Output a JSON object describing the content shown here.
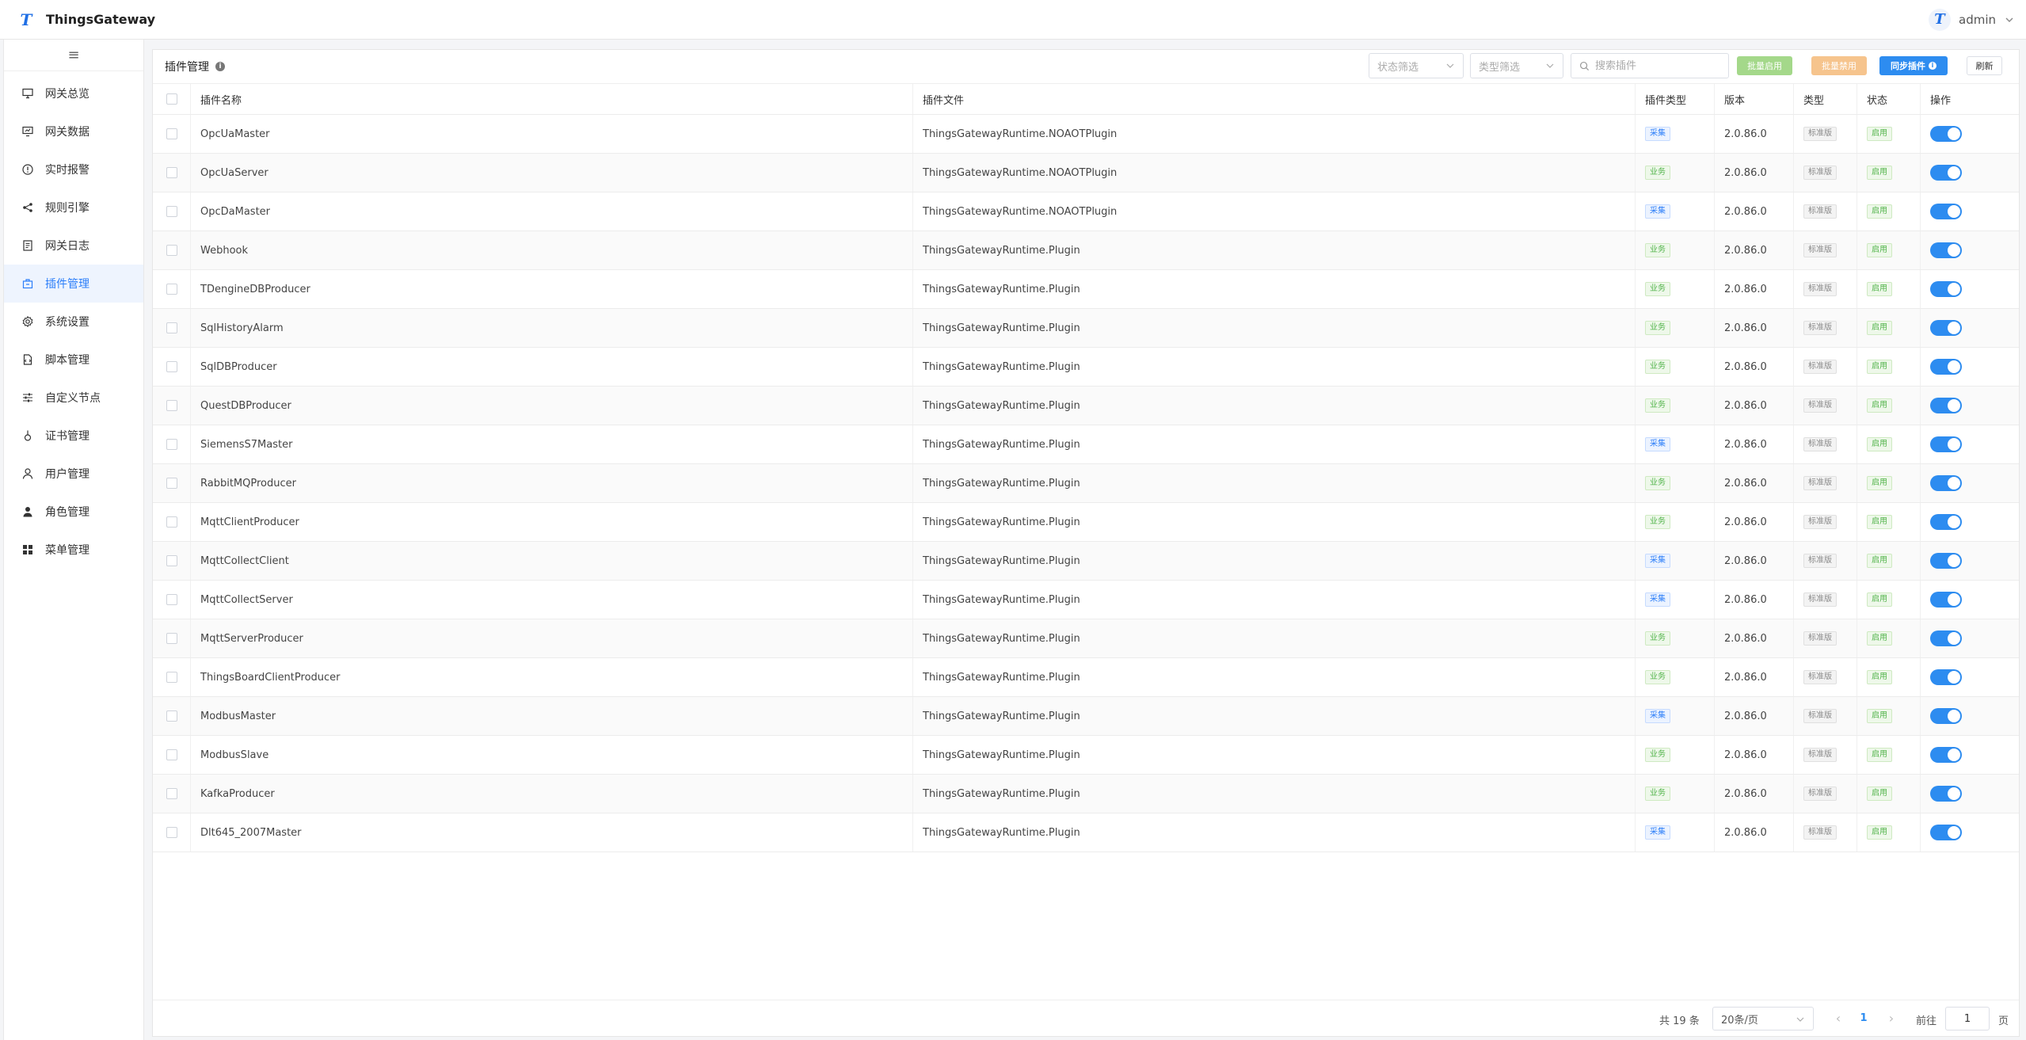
{
  "app": {
    "title": "ThingsGateway",
    "logo_letter": "T"
  },
  "user": {
    "name": "admin",
    "avatar_letter": "T"
  },
  "sidebar": {
    "collapse_glyph": "≡",
    "items": [
      {
        "label": "网关总览",
        "icon": "monitor-icon"
      },
      {
        "label": "网关数据",
        "icon": "dashboard-icon"
      },
      {
        "label": "实时报警",
        "icon": "alert-icon"
      },
      {
        "label": "规则引擎",
        "icon": "share-icon"
      },
      {
        "label": "网关日志",
        "icon": "log-icon"
      },
      {
        "label": "插件管理",
        "icon": "plugin-icon",
        "active": true
      },
      {
        "label": "系统设置",
        "icon": "gear-icon"
      },
      {
        "label": "脚本管理",
        "icon": "script-icon"
      },
      {
        "label": "自定义节点",
        "icon": "sliders-icon"
      },
      {
        "label": "证书管理",
        "icon": "certificate-icon"
      },
      {
        "label": "用户管理",
        "icon": "user-icon"
      },
      {
        "label": "角色管理",
        "icon": "role-icon"
      },
      {
        "label": "菜单管理",
        "icon": "grid-icon"
      }
    ]
  },
  "toolbar": {
    "title": "插件管理",
    "status_filter_placeholder": "状态筛选",
    "type_filter_placeholder": "类型筛选",
    "search_placeholder": "搜索插件",
    "batch_enable": "批量启用",
    "batch_disable": "批量禁用",
    "sync": "同步插件",
    "refresh": "刷新"
  },
  "table": {
    "columns": {
      "name": "插件名称",
      "file": "插件文件",
      "plugin_type": "插件类型",
      "version": "版本",
      "type": "类型",
      "status": "状态",
      "operation": "操作"
    },
    "rows": [
      {
        "name": "OpcUaMaster",
        "file": "ThingsGatewayRuntime.NOAOTPlugin",
        "plugin_type": "采集",
        "version": "2.0.86.0",
        "type": "标准版",
        "status": "启用",
        "enabled": true
      },
      {
        "name": "OpcUaServer",
        "file": "ThingsGatewayRuntime.NOAOTPlugin",
        "plugin_type": "业务",
        "version": "2.0.86.0",
        "type": "标准版",
        "status": "启用",
        "enabled": true
      },
      {
        "name": "OpcDaMaster",
        "file": "ThingsGatewayRuntime.NOAOTPlugin",
        "plugin_type": "采集",
        "version": "2.0.86.0",
        "type": "标准版",
        "status": "启用",
        "enabled": true
      },
      {
        "name": "Webhook",
        "file": "ThingsGatewayRuntime.Plugin",
        "plugin_type": "业务",
        "version": "2.0.86.0",
        "type": "标准版",
        "status": "启用",
        "enabled": true
      },
      {
        "name": "TDengineDBProducer",
        "file": "ThingsGatewayRuntime.Plugin",
        "plugin_type": "业务",
        "version": "2.0.86.0",
        "type": "标准版",
        "status": "启用",
        "enabled": true
      },
      {
        "name": "SqlHistoryAlarm",
        "file": "ThingsGatewayRuntime.Plugin",
        "plugin_type": "业务",
        "version": "2.0.86.0",
        "type": "标准版",
        "status": "启用",
        "enabled": true
      },
      {
        "name": "SqlDBProducer",
        "file": "ThingsGatewayRuntime.Plugin",
        "plugin_type": "业务",
        "version": "2.0.86.0",
        "type": "标准版",
        "status": "启用",
        "enabled": true
      },
      {
        "name": "QuestDBProducer",
        "file": "ThingsGatewayRuntime.Plugin",
        "plugin_type": "业务",
        "version": "2.0.86.0",
        "type": "标准版",
        "status": "启用",
        "enabled": true
      },
      {
        "name": "SiemensS7Master",
        "file": "ThingsGatewayRuntime.Plugin",
        "plugin_type": "采集",
        "version": "2.0.86.0",
        "type": "标准版",
        "status": "启用",
        "enabled": true
      },
      {
        "name": "RabbitMQProducer",
        "file": "ThingsGatewayRuntime.Plugin",
        "plugin_type": "业务",
        "version": "2.0.86.0",
        "type": "标准版",
        "status": "启用",
        "enabled": true
      },
      {
        "name": "MqttClientProducer",
        "file": "ThingsGatewayRuntime.Plugin",
        "plugin_type": "业务",
        "version": "2.0.86.0",
        "type": "标准版",
        "status": "启用",
        "enabled": true
      },
      {
        "name": "MqttCollectClient",
        "file": "ThingsGatewayRuntime.Plugin",
        "plugin_type": "采集",
        "version": "2.0.86.0",
        "type": "标准版",
        "status": "启用",
        "enabled": true
      },
      {
        "name": "MqttCollectServer",
        "file": "ThingsGatewayRuntime.Plugin",
        "plugin_type": "采集",
        "version": "2.0.86.0",
        "type": "标准版",
        "status": "启用",
        "enabled": true
      },
      {
        "name": "MqttServerProducer",
        "file": "ThingsGatewayRuntime.Plugin",
        "plugin_type": "业务",
        "version": "2.0.86.0",
        "type": "标准版",
        "status": "启用",
        "enabled": true
      },
      {
        "name": "ThingsBoardClientProducer",
        "file": "ThingsGatewayRuntime.Plugin",
        "plugin_type": "业务",
        "version": "2.0.86.0",
        "type": "标准版",
        "status": "启用",
        "enabled": true
      },
      {
        "name": "ModbusMaster",
        "file": "ThingsGatewayRuntime.Plugin",
        "plugin_type": "采集",
        "version": "2.0.86.0",
        "type": "标准版",
        "status": "启用",
        "enabled": true
      },
      {
        "name": "ModbusSlave",
        "file": "ThingsGatewayRuntime.Plugin",
        "plugin_type": "业务",
        "version": "2.0.86.0",
        "type": "标准版",
        "status": "启用",
        "enabled": true
      },
      {
        "name": "KafkaProducer",
        "file": "ThingsGatewayRuntime.Plugin",
        "plugin_type": "业务",
        "version": "2.0.86.0",
        "type": "标准版",
        "status": "启用",
        "enabled": true
      },
      {
        "name": "Dlt645_2007Master",
        "file": "ThingsGatewayRuntime.Plugin",
        "plugin_type": "采集",
        "version": "2.0.86.0",
        "type": "标准版",
        "status": "启用",
        "enabled": true
      }
    ]
  },
  "pagination": {
    "total": "共 19 条",
    "page_size": "20条/页",
    "current_page": "1",
    "goto_label": "前往",
    "goto_value": "1",
    "page_unit": "页",
    "prev_glyph": "‹",
    "next_glyph": "›"
  },
  "colors": {
    "accent": "#2d8cf0",
    "active_menu_bg": "#eef4fe",
    "batch_enable": "#a4d88a",
    "batch_disable": "#f6c48d"
  }
}
